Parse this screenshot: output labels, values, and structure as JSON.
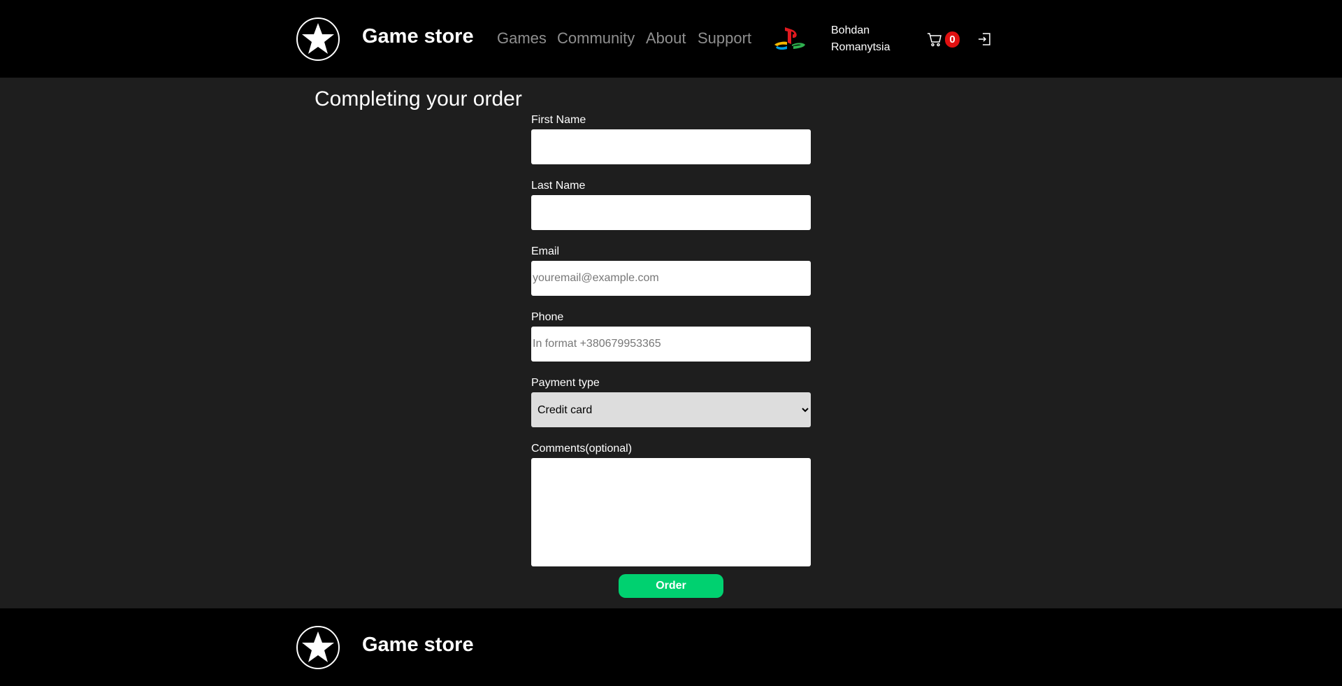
{
  "header": {
    "brand": "Game store",
    "nav": [
      "Games",
      "Community",
      "About",
      "Support"
    ],
    "user_first": "Bohdan",
    "user_last": "Romanytsia",
    "cart_count": "0"
  },
  "page": {
    "title": "Completing your order"
  },
  "form": {
    "first_name_label": "First Name",
    "first_name_value": "",
    "last_name_label": "Last Name",
    "last_name_value": "",
    "email_label": "Email",
    "email_placeholder": "youremail@example.com",
    "phone_label": "Phone",
    "phone_placeholder": "In format +380679953365",
    "payment_label": "Payment type",
    "payment_selected": "Credit card",
    "comments_label": "Comments(optional)",
    "comments_value": "",
    "order_button": "Order"
  },
  "footer": {
    "brand": "Game store"
  },
  "icons": {
    "logo": "star-logo-icon",
    "platform": "playstation-icon",
    "cart": "cart-icon",
    "logout": "logout-icon"
  },
  "colors": {
    "header_bg": "#000000",
    "page_bg": "#1e1e1e",
    "accent": "#00d170",
    "badge": "#e01010",
    "nav_text": "#8f8f8f"
  }
}
